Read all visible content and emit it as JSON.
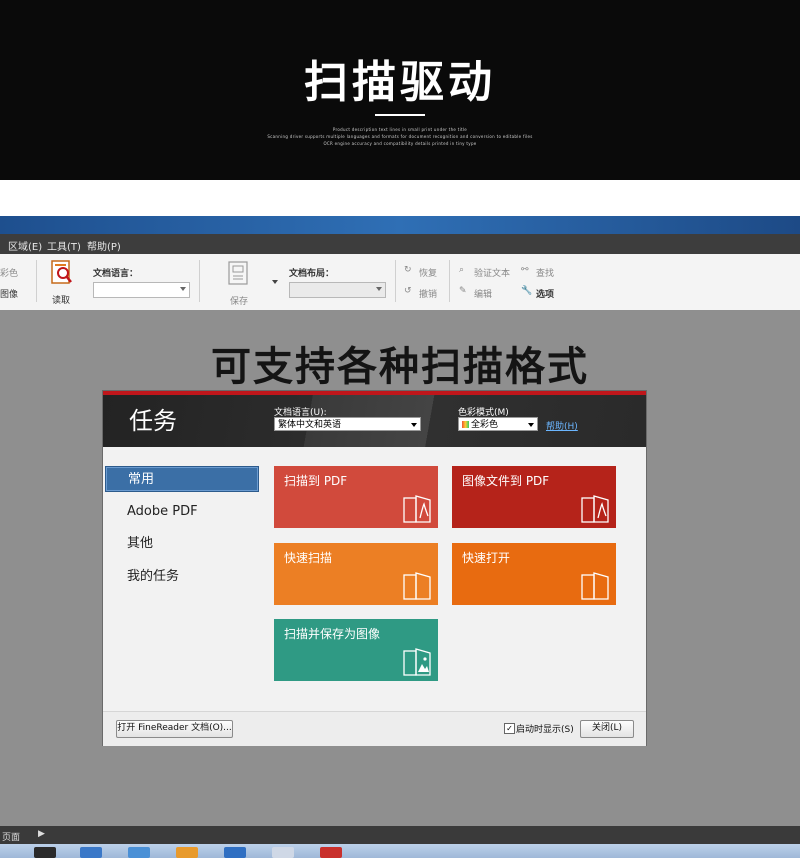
{
  "banner": {
    "title": "扫描驱动",
    "subtitle_lines": [
      "Product description text lines in small print under the title",
      "Scanning driver supports multiple languages and formats for document recognition and conversion to editable files",
      "OCR engine accuracy and compatibility details printed in tiny type"
    ]
  },
  "menubar": {
    "items": [
      "区域(E)",
      "工具(T)",
      "帮助(P)"
    ]
  },
  "toolbar": {
    "left_cut_1": "彩色",
    "left_cut_2": "图像",
    "read_label": "读取",
    "doc_lang_label": "文档语言：",
    "save_label": "保存",
    "doc_layout_label": "文档布局：",
    "restore_label": "恢复",
    "undo_label": "撤销",
    "verify_label": "验证文本",
    "edit_label": "编辑",
    "find_label": "查找",
    "options_label": "选项"
  },
  "headline": "可支持各种扫描格式",
  "dialog": {
    "title": "任务",
    "doc_lang_label": "文档语言(U):",
    "doc_lang_value": "繁体中文和英语",
    "color_mode_label": "色彩模式(M)",
    "color_mode_value": "全彩色",
    "help_link": "帮助(H)",
    "nav": [
      "常用",
      "Adobe PDF",
      "其他",
      "我的任务"
    ],
    "tiles": [
      {
        "label": "扫描到 PDF",
        "color": "#d14a3c",
        "icon": "pdf-icon"
      },
      {
        "label": "图像文件到 PDF",
        "color": "#b5231a",
        "icon": "pdf-icon"
      },
      {
        "label": "快速扫描",
        "color": "#ec7f24",
        "icon": "document-icon"
      },
      {
        "label": "快速打开",
        "color": "#e86b10",
        "icon": "document-icon"
      },
      {
        "label": "扫描并保存为图像",
        "color": "#2f9a84",
        "icon": "image-icon"
      }
    ],
    "open_button": "打开 FineReader 文档(O)...",
    "show_on_start_label": "启动时显示(S)",
    "close_button": "关闭(L)"
  },
  "statusbar": {
    "text": "页面"
  }
}
